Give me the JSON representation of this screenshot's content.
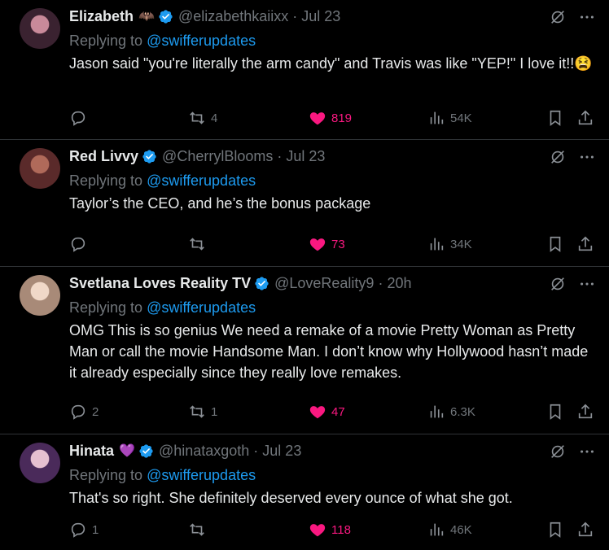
{
  "tweets": [
    {
      "name": "Elizabeth",
      "badge": "🦇",
      "verified": true,
      "handle": "@elizabethkaiixx",
      "time": "Jul 23",
      "replying_label": "Replying to",
      "replying_to": "@swifferupdates",
      "text": "Jason said \"you're literally the arm candy\" and Travis was like \"YEP!\" I love it!!😫",
      "replies": "",
      "retweets": "4",
      "likes": "819",
      "views": "54K",
      "avatar_color": "#5a3b4f"
    },
    {
      "name": "Red Livvy",
      "badge": "",
      "verified": true,
      "handle": "@CherrylBlooms",
      "time": "Jul 23",
      "replying_label": "Replying to",
      "replying_to": "@swifferupdates",
      "text": "Taylor’s the CEO, and he’s the bonus package",
      "replies": "",
      "retweets": "",
      "likes": "73",
      "views": "34K",
      "avatar_color": "#8a3b3b"
    },
    {
      "name": "Svetlana Loves Reality TV",
      "badge": "",
      "verified": true,
      "handle": "@LoveReality9",
      "time": "20h",
      "replying_label": "Replying to",
      "replying_to": "@swifferupdates",
      "text": "OMG This is so genius We need a remake of a movie Pretty Woman as Pretty Man or call the movie Handsome Man. I don’t know why Hollywood hasn’t made it already especially since they really love remakes.",
      "replies": "2",
      "retweets": "1",
      "likes": "47",
      "views": "6.3K",
      "avatar_color": "#c9b4a4"
    },
    {
      "name": "Hinata",
      "badge": "💜",
      "verified": true,
      "handle": "@hinataxgoth",
      "time": "Jul 23",
      "replying_label": "Replying to",
      "replying_to": "@swifferupdates",
      "text": "That's so right. She definitely deserved every ounce of what she got.",
      "replies": "1",
      "retweets": "",
      "likes": "118",
      "views": "46K",
      "avatar_color": "#6b4a7a"
    }
  ],
  "colors": {
    "background": "#000000",
    "muted": "#71767b",
    "mention": "#1d9bf0",
    "like": "#f91880",
    "verified": "#1d9bf0"
  },
  "icons": [
    "reply-icon",
    "retweet-icon",
    "heart-icon",
    "views-icon",
    "bookmark-icon",
    "share-icon",
    "grok-icon",
    "more-icon",
    "verified-badge-icon"
  ]
}
